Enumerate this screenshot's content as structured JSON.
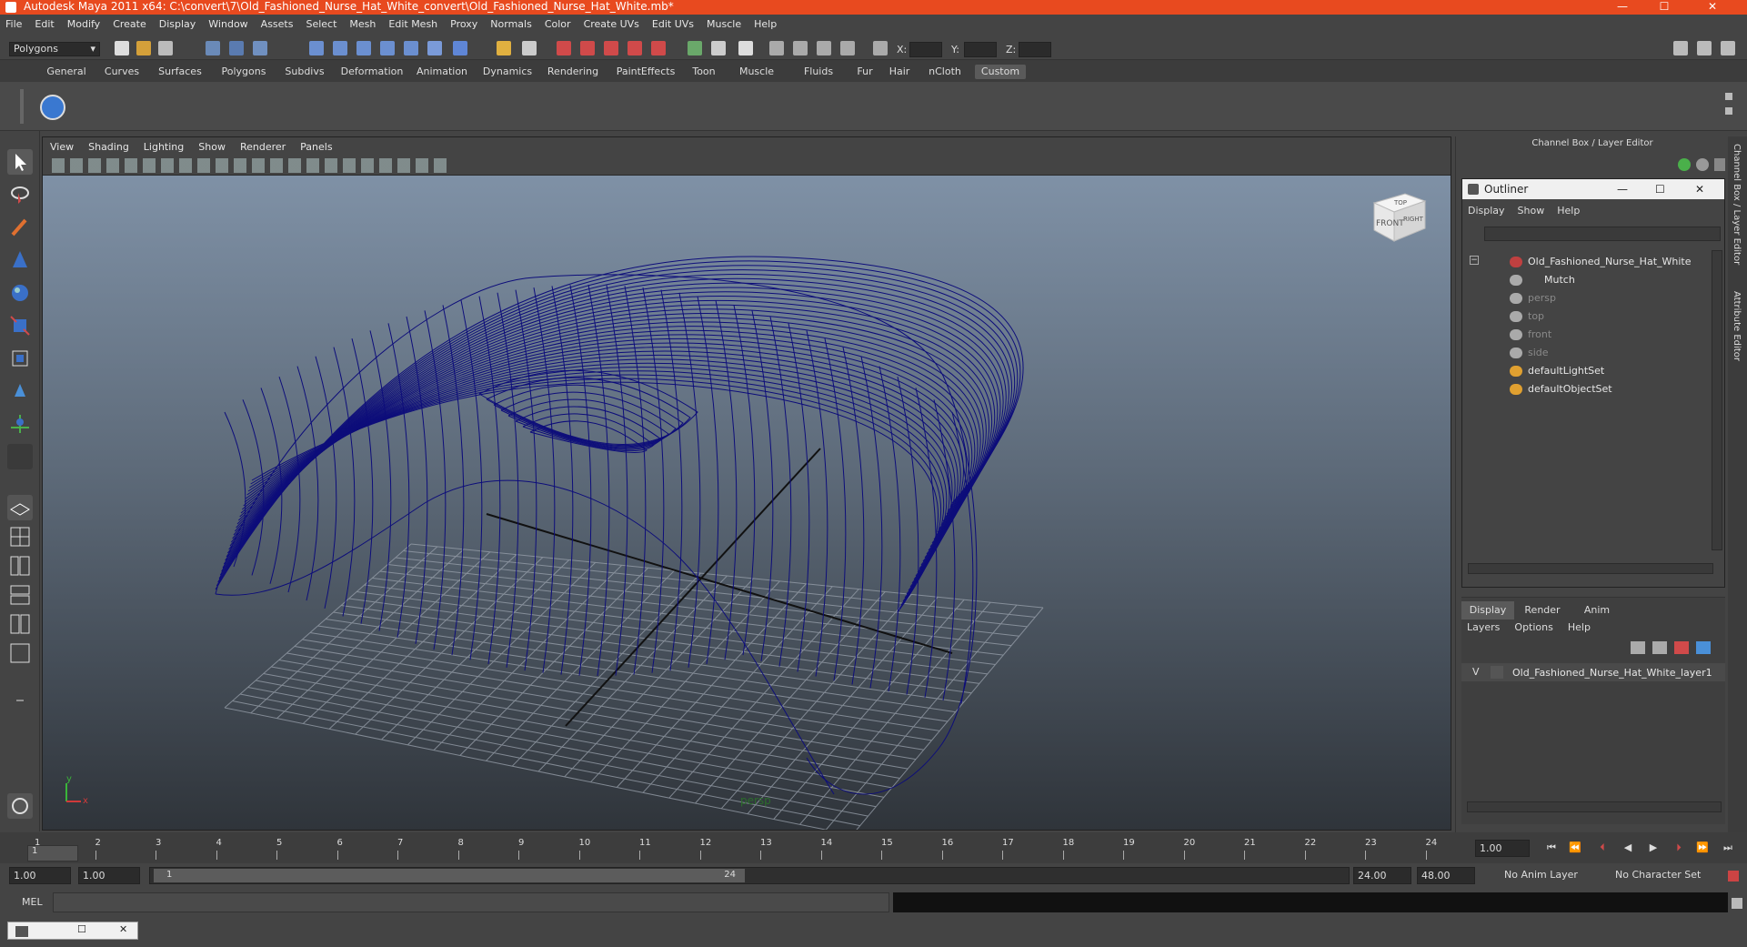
{
  "window": {
    "title": "Autodesk Maya 2011 x64: C:\\convert\\7\\Old_Fashioned_Nurse_Hat_White_convert\\Old_Fashioned_Nurse_Hat_White.mb*",
    "minimize": "—",
    "maximize": "☐",
    "close": "✕"
  },
  "menubar": [
    "File",
    "Edit",
    "Modify",
    "Create",
    "Display",
    "Window",
    "Assets",
    "Select",
    "Mesh",
    "Edit Mesh",
    "Proxy",
    "Normals",
    "Color",
    "Create UVs",
    "Edit UVs",
    "Muscle",
    "Help"
  ],
  "statusline": {
    "mode": "Polygons",
    "x_label": "X:",
    "y_label": "Y:",
    "z_label": "Z:"
  },
  "shelf_tabs": [
    "General",
    "Curves",
    "Surfaces",
    "Polygons",
    "Subdivs",
    "Deformation",
    "Animation",
    "Dynamics",
    "Rendering",
    "PaintEffects",
    "Toon",
    "Muscle",
    "Fluids",
    "Fur",
    "Hair",
    "nCloth",
    "Custom"
  ],
  "viewport": {
    "menus": [
      "View",
      "Shading",
      "Lighting",
      "Show",
      "Renderer",
      "Panels"
    ],
    "camera_label": "persp",
    "viewcube_front": "FRONT",
    "viewcube_right": "RIGHT",
    "viewcube_top": "TOP",
    "axis_y": "y",
    "axis_x": "x"
  },
  "right_panel": {
    "header": "Channel Box / Layer Editor",
    "side_tab_1": "Channel Box / Layer Editor",
    "side_tab_2": "Attribute Editor",
    "outliner": {
      "title": "Outliner",
      "menus": [
        "Display",
        "Show",
        "Help"
      ],
      "items": [
        {
          "label": "Old_Fashioned_Nurse_Hat_White",
          "dim": false
        },
        {
          "label": "Mutch",
          "dim": false
        },
        {
          "label": "persp",
          "dim": true
        },
        {
          "label": "top",
          "dim": true
        },
        {
          "label": "front",
          "dim": true
        },
        {
          "label": "side",
          "dim": true
        },
        {
          "label": "defaultLightSet",
          "dim": false
        },
        {
          "label": "defaultObjectSet",
          "dim": false
        }
      ]
    },
    "layer_tabs": [
      "Display",
      "Render",
      "Anim"
    ],
    "layer_menus": [
      "Layers",
      "Options",
      "Help"
    ],
    "layer": {
      "visible": "V",
      "name": "Old_Fashioned_Nurse_Hat_White_layer1"
    }
  },
  "timeline": {
    "ticks": [
      "1",
      "2",
      "3",
      "4",
      "5",
      "6",
      "7",
      "8",
      "9",
      "10",
      "11",
      "12",
      "13",
      "14",
      "15",
      "16",
      "17",
      "18",
      "19",
      "20",
      "21",
      "22",
      "23",
      "24"
    ],
    "current_frame_marker": "1",
    "current_time": "1.00"
  },
  "range": {
    "start": "1.00",
    "playback_start": "1.00",
    "slider_start": "1",
    "slider_end": "24",
    "playback_end": "24.00",
    "end": "48.00",
    "anim_layer": "No Anim Layer",
    "character_set": "No Character Set"
  },
  "command": {
    "label": "MEL"
  },
  "colors": {
    "title_bar": "#e84a1f",
    "wireframe": "#0d0d7a",
    "active_tab": "#5a5a5a"
  }
}
